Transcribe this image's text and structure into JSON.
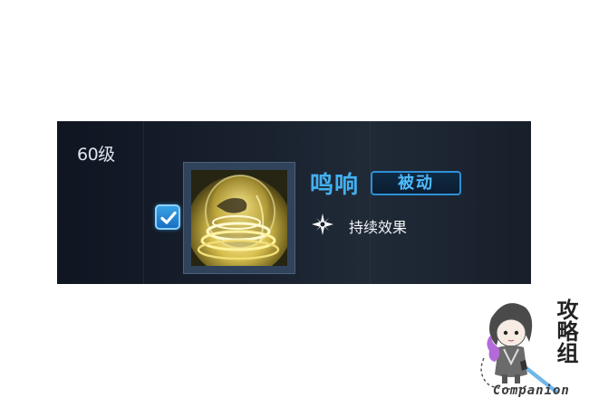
{
  "level": {
    "label": "60级"
  },
  "skill": {
    "name": "鸣响",
    "type_badge": "被动",
    "effect_label": "持续效果",
    "enabled": true,
    "icon": "golden-sphere-skill-icon"
  },
  "watermark": {
    "caption": "Companion",
    "logo_text": "攻略组"
  },
  "colors": {
    "panel_bg": "#1a2230",
    "accent_blue": "#43b1f0",
    "icon_gold": "#e8d27a"
  }
}
